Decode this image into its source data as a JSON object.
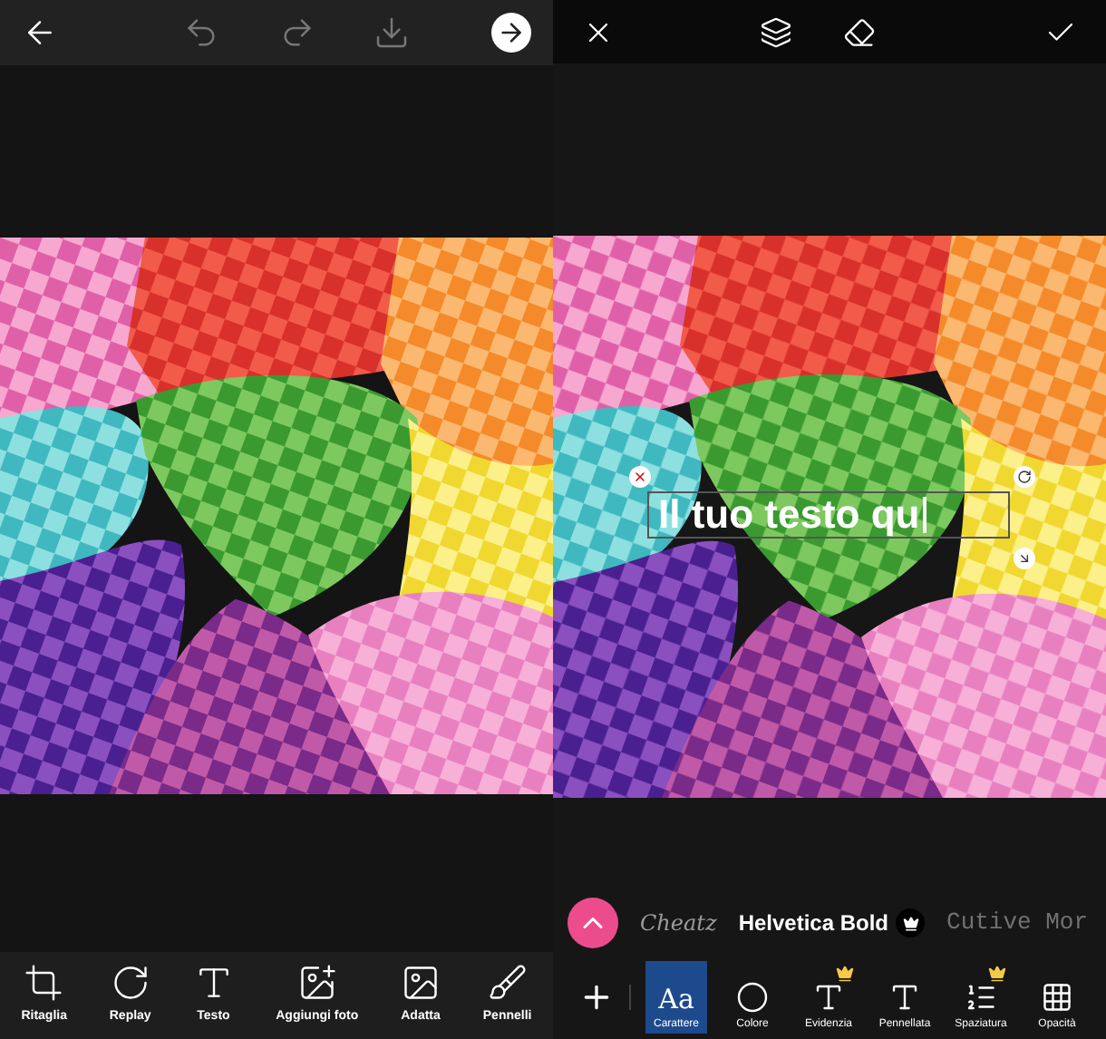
{
  "left_panel": {
    "top_bar": {
      "buttons": [
        {
          "kind": "back"
        },
        {
          "kind": "undo",
          "disabled": true
        },
        {
          "kind": "redo",
          "disabled": true
        },
        {
          "kind": "download",
          "disabled": true
        },
        {
          "kind": "next"
        }
      ]
    },
    "tools": [
      {
        "label": "Ritaglia",
        "kind": "crop"
      },
      {
        "label": "Replay",
        "kind": "replay"
      },
      {
        "label": "Testo",
        "kind": "text"
      },
      {
        "label": "Aggiungi foto",
        "kind": "add-photo"
      },
      {
        "label": "Adatta",
        "kind": "fit"
      },
      {
        "label": "Pennelli",
        "kind": "brushes"
      }
    ]
  },
  "right_panel": {
    "top_bar": {
      "buttons": [
        {
          "kind": "close"
        },
        {
          "kind": "layers"
        },
        {
          "kind": "eraser"
        },
        {
          "kind": "confirm"
        }
      ]
    },
    "text_overlay": {
      "text": "Il tuo testo qu"
    },
    "fonts": [
      {
        "label": "Cheatz",
        "kind": "script",
        "premium": false,
        "selected": false
      },
      {
        "label": "Helvetica Bold",
        "kind": "sans",
        "premium": true,
        "selected": true
      },
      {
        "label": "Cutive Mor",
        "kind": "mono",
        "premium": false,
        "selected": false
      }
    ],
    "tools": [
      {
        "label": "Carattere",
        "kind": "font",
        "glyph": "Aa",
        "selected": true,
        "premium": false
      },
      {
        "label": "Colore",
        "kind": "color",
        "selected": false,
        "premium": false
      },
      {
        "label": "Evidenzia",
        "kind": "highlight",
        "selected": false,
        "premium": true
      },
      {
        "label": "Pennellata",
        "kind": "stroke",
        "selected": false,
        "premium": false
      },
      {
        "label": "Spaziatura",
        "kind": "spacing",
        "selected": false,
        "premium": true
      },
      {
        "label": "Opacità",
        "kind": "opacity",
        "selected": false,
        "premium": false
      }
    ]
  }
}
